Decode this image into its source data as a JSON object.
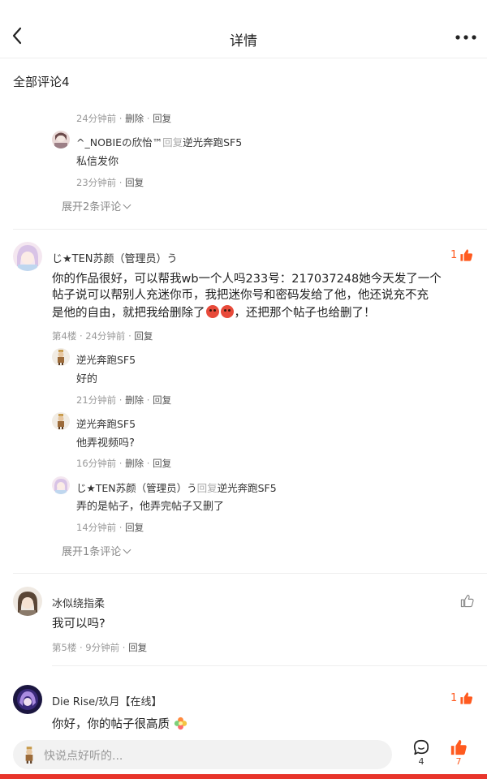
{
  "header": {
    "title": "详情"
  },
  "section_title": "全部评论4",
  "comment3_replies": {
    "top_meta": {
      "time": "24分钟前",
      "sep1": " · ",
      "delete": "删除",
      "sep2": " · ",
      "reply": "回复"
    },
    "reply": {
      "name": "^_NOBIEの欣怡™",
      "reply_word": "回复",
      "target": "逆光奔跑SF5",
      "text": "私信发你",
      "time": "23分钟前",
      "sep": " · ",
      "reply_action": "回复"
    },
    "expand": "展开2条评论"
  },
  "comment4": {
    "name": "じ★TEN苏颜（管理员）う",
    "like_count": "1",
    "text_line1": "你的作品很好，可以帮我wb一个人吗233号：217037248她今天发了一个",
    "text_line2": "帖子说可以帮别人充迷你币，我把迷你号和密码发给了他，他还说充不充",
    "text_line3a": "是他的自由，就把我给删除了",
    "text_line3b": "，还把那个帖子也给删了！",
    "meta": {
      "floor": "第4楼",
      "sep1": " · ",
      "time": "24分钟前",
      "sep2": " · ",
      "reply": "回复"
    },
    "replies": [
      {
        "name": "逆光奔跑SF5",
        "text": "好的",
        "time": "21分钟前",
        "delete": "删除",
        "reply": "回复"
      },
      {
        "name": "逆光奔跑SF5",
        "text": "他弄视频吗?",
        "time": "16分钟前",
        "delete": "删除",
        "reply": "回复"
      },
      {
        "name": "じ★TEN苏颜（管理员）う",
        "reply_word": "回复",
        "target": "逆光奔跑SF5",
        "text": "弄的是帖子，他弄完帖子又删了",
        "time": "14分钟前",
        "reply": "回复"
      }
    ],
    "expand": "展开1条评论"
  },
  "comment5": {
    "name": "冰似绕指柔",
    "text": "我可以吗?",
    "meta": {
      "floor": "第5楼",
      "sep1": " · ",
      "time": "9分钟前",
      "sep2": " · ",
      "reply": "回复"
    }
  },
  "comment6": {
    "name": "Die Rise/玖月【在线】",
    "like_count": "1",
    "text": "你好，你的帖子很高质"
  },
  "bottom_bar": {
    "placeholder": "快说点好听的...",
    "comment_count": "4",
    "like_count": "7"
  },
  "colors": {
    "accent": "#ff5a1f",
    "bottom_strip": "#e8352b"
  },
  "icons": [
    "back-arrow-icon",
    "more-dots-icon",
    "thumb-up-icon",
    "comment-bubble-icon",
    "angry-face-emoji",
    "flower-emoji"
  ]
}
